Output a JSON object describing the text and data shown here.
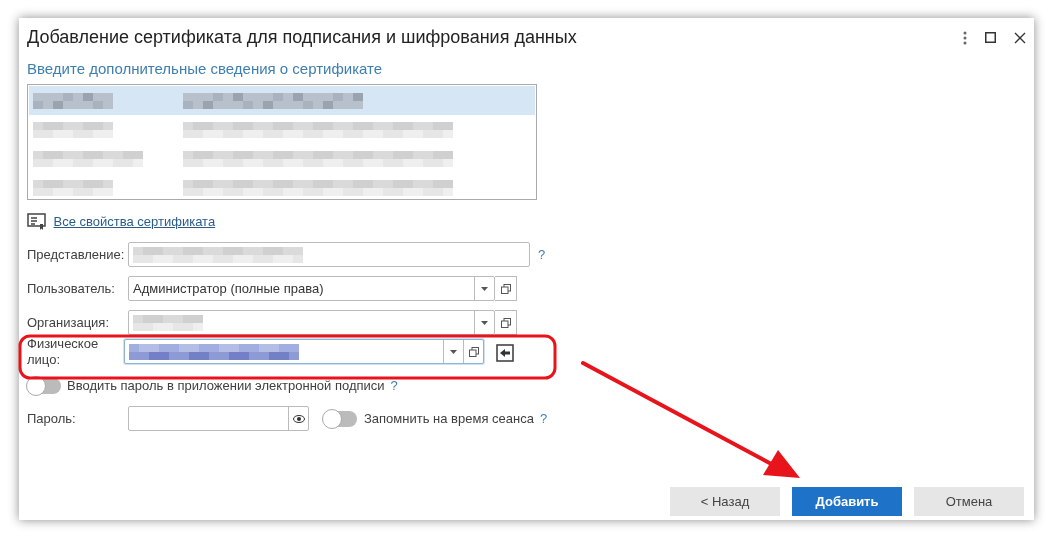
{
  "window": {
    "title": "Добавление сертификата для подписания и шифрования данных"
  },
  "subtitle": "Введите дополнительные сведения о сертификате",
  "properties_table": {
    "rows": [
      {
        "selected": true
      },
      {
        "selected": false
      },
      {
        "selected": false
      },
      {
        "selected": false
      }
    ]
  },
  "properties_link": "Все свойства сертификата",
  "fields": [
    {
      "kind": "text",
      "label": "Представление:",
      "redacted": true,
      "help": "?"
    },
    {
      "kind": "select",
      "label": "Пользователь:",
      "value": "Администратор (полные права)"
    },
    {
      "kind": "select",
      "label": "Организация:",
      "redacted": true
    },
    {
      "kind": "select",
      "label": "Физическое лицо:",
      "redacted": true,
      "focused": true,
      "extra_button": true,
      "highlighted": true
    }
  ],
  "enter_password_toggle": {
    "label": "Вводить пароль в приложении электронной подписи",
    "on": false,
    "help": "?"
  },
  "password": {
    "label": "Пароль:"
  },
  "remember_toggle": {
    "label": "Запомнить на время сеанса",
    "on": false,
    "help": "?"
  },
  "buttons": [
    {
      "label": "< Назад",
      "primary": false
    },
    {
      "label": "Добавить",
      "primary": true
    },
    {
      "label": "Отмена",
      "primary": false
    }
  ],
  "arrow_annotation": true
}
